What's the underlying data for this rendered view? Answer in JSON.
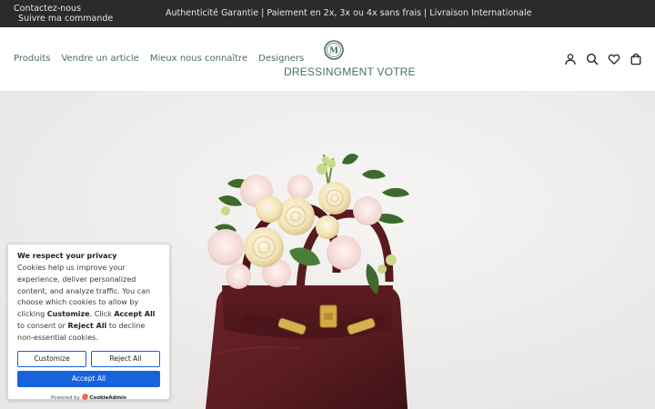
{
  "topbar": {
    "contact": "Contactez-nous",
    "track_order": "Suivre ma commande",
    "announcement": "Authenticité Garantie | Paiement en 2x, 3x ou 4x sans frais | Livraison Internationale"
  },
  "nav": {
    "items": [
      "Produits",
      "Vendre un article",
      "Mieux nous connaître",
      "Designers"
    ]
  },
  "logo": {
    "brand": "DRESSINGMENT VOTRE"
  },
  "header_icons": [
    "account-icon",
    "search-icon",
    "heart-icon",
    "cart-icon"
  ],
  "cookie": {
    "title": "We respect your privacy",
    "text_1": "Cookies help us improve your experience, deliver personalized content, and analyze traffic. You can choose which cookies to allow by clicking ",
    "customize_word": "Customize",
    "text_2": ". Click ",
    "accept_word": "Accept All",
    "text_3": " to consent or ",
    "reject_word": "Reject All",
    "text_4": " to decline non-essential cookies.",
    "customize_label": "Customize",
    "reject_label": "Reject All",
    "accept_label": "Accept All",
    "powered_by": "Powered by",
    "provider": "CookieAdmin"
  },
  "colors": {
    "topbar_bg": "#2b2b2b",
    "brand_green": "#4b6e63",
    "accept_blue": "#1863dc",
    "bag": "#5e1e23"
  }
}
